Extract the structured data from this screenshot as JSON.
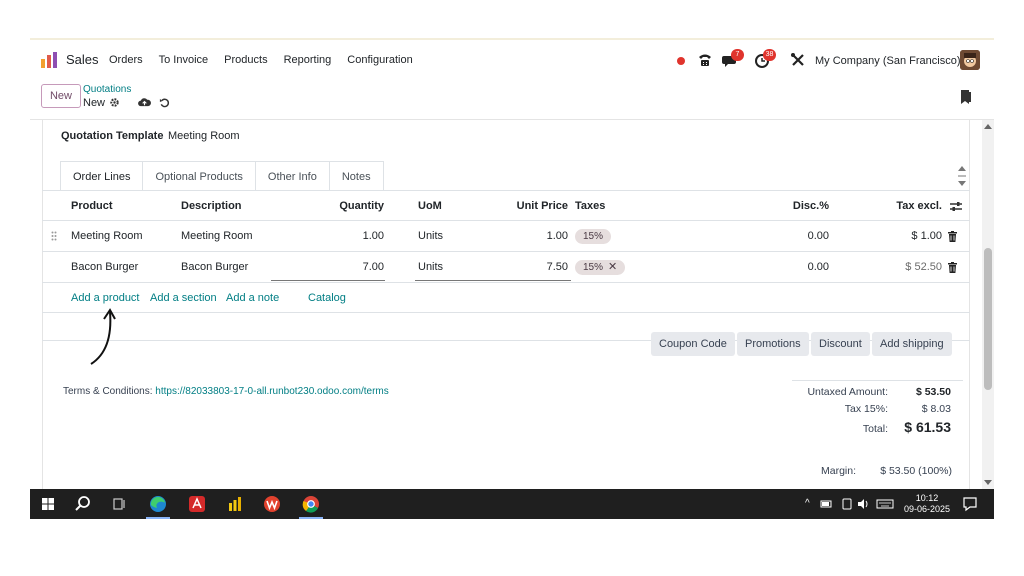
{
  "navbar": {
    "app_name": "Sales",
    "menu": [
      "Orders",
      "To Invoice",
      "Products",
      "Reporting",
      "Configuration"
    ],
    "messages_badge": "7",
    "activities_badge": "38",
    "company": "My Company (San Francisco)"
  },
  "control": {
    "new_label": "New",
    "breadcrumb_parent": "Quotations",
    "breadcrumb_current": "New"
  },
  "form": {
    "quotation_template_label": "Quotation Template",
    "quotation_template_value": "Meeting Room",
    "tabs": [
      "Order Lines",
      "Optional Products",
      "Other Info",
      "Notes"
    ]
  },
  "table": {
    "headers": {
      "product": "Product",
      "description": "Description",
      "quantity": "Quantity",
      "uom": "UoM",
      "unit_price": "Unit Price",
      "taxes": "Taxes",
      "disc": "Disc.%",
      "tax_excl": "Tax excl."
    },
    "rows": [
      {
        "product": "Meeting Room",
        "description": "Meeting Room",
        "quantity": "1.00",
        "uom": "Units",
        "unit_price": "1.00",
        "tax": "15%",
        "disc": "0.00",
        "subtotal": "$ 1.00"
      },
      {
        "product": "Bacon Burger",
        "description": "Bacon Burger",
        "quantity": "7.00",
        "uom": "Units",
        "unit_price": "7.50",
        "tax": "15%",
        "disc": "0.00",
        "subtotal": "$ 52.50"
      }
    ],
    "add_links": {
      "product": "Add a product",
      "section": "Add a section",
      "note": "Add a note",
      "catalog": "Catalog"
    }
  },
  "actions": {
    "coupon": "Coupon Code",
    "promotions": "Promotions",
    "discount": "Discount",
    "shipping": "Add shipping"
  },
  "terms": {
    "label": "Terms & Conditions:",
    "url": "https://82033803-17-0-all.runbot230.odoo.com/terms"
  },
  "totals": {
    "untaxed_label": "Untaxed Amount:",
    "untaxed_value": "$ 53.50",
    "tax_label": "Tax 15%:",
    "tax_value": "$ 8.03",
    "total_label": "Total:",
    "total_value": "$ 61.53",
    "margin_label": "Margin:",
    "margin_value": "$ 53.50 (100%)"
  },
  "taskbar": {
    "time": "10:12",
    "date": "09-06-2025"
  },
  "colors": {
    "odoo_purple": "#714b67",
    "teal_link": "#017e84",
    "badge_red": "#e0342d"
  }
}
